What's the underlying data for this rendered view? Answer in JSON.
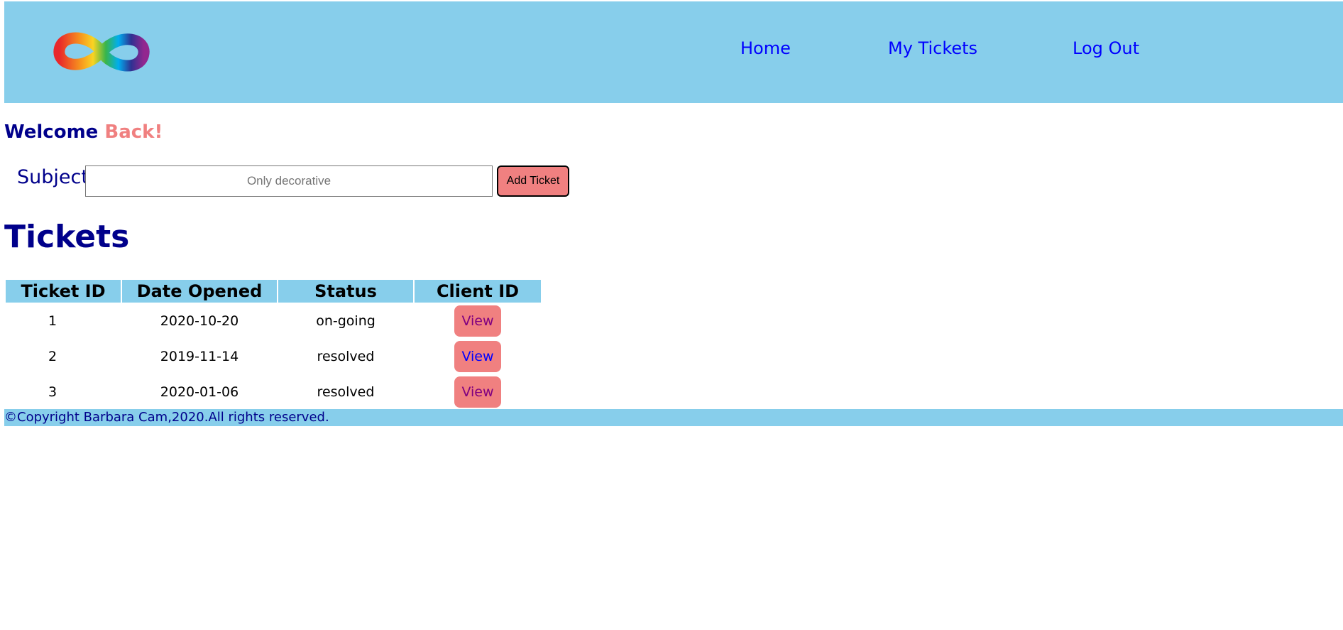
{
  "header": {
    "logo_alt": "Infinity logo",
    "nav": {
      "home": "Home",
      "my_tickets": "My Tickets",
      "log_out": "Log Out"
    }
  },
  "welcome": {
    "prefix": "Welcome",
    "accent": "Back!"
  },
  "form": {
    "subject_label": "Subject",
    "subject_placeholder": "Only decorative",
    "subject_value": "",
    "add_button": "Add Ticket"
  },
  "tickets": {
    "title": "Tickets",
    "columns": [
      "Ticket ID",
      "Date Opened",
      "Status",
      "Client ID"
    ],
    "rows": [
      {
        "id": "1",
        "date": "2020-10-20",
        "status": "on-going",
        "action": "View"
      },
      {
        "id": "2",
        "date": "2019-11-14",
        "status": "resolved",
        "action": "View"
      },
      {
        "id": "3",
        "date": "2020-01-06",
        "status": "resolved",
        "action": "View"
      }
    ]
  },
  "footer": {
    "text": "©Copyright Barbara Cam,2020.All rights reserved."
  },
  "colors": {
    "header_bg": "#87ceeb",
    "heading": "#00008b",
    "accent": "#f08080",
    "link": "#0000ff",
    "visited_link": "#800080"
  }
}
